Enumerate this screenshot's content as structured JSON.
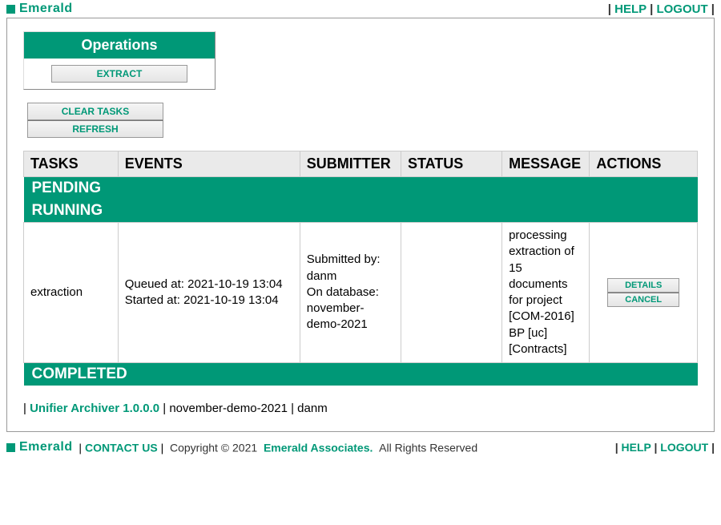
{
  "brand": "Emerald",
  "top": {
    "help": "HELP",
    "logout": "LOGOUT"
  },
  "ops": {
    "header": "Operations",
    "extract": "EXTRACT"
  },
  "util": {
    "clear": "CLEAR TASKS",
    "refresh": "REFRESH"
  },
  "table": {
    "headers": {
      "tasks": "TASKS",
      "events": "EVENTS",
      "submitter": "SUBMITTER",
      "status": "STATUS",
      "message": "MESSAGE",
      "actions": "ACTIONS"
    },
    "sections": {
      "pending": "PENDING",
      "running": "RUNNING",
      "completed": "COMPLETED"
    },
    "row": {
      "task": "extraction",
      "queued_label": "Queued at:",
      "queued": "2021-10-19 13:04",
      "started_label": "Started at:",
      "started": "2021-10-19 13:04",
      "submitted_by_label": "Submitted by:",
      "submitted_by": "danm",
      "on_db_label": "On database:",
      "on_db": "november-demo-2021",
      "status": "",
      "message": "processing extraction of 15 documents for project [COM-2016] BP [uc] [Contracts]",
      "details": "DETAILS",
      "cancel": "CANCEL"
    }
  },
  "footer": {
    "product": "Unifier Archiver",
    "version": "1.0.0.0",
    "db": "november-demo-2021",
    "user": "danm"
  },
  "bottom": {
    "contact": "CONTACT US",
    "copyright_prefix": "Copyright © 2021",
    "associates": "Emerald Associates.",
    "rights": "All Rights Reserved",
    "help": "HELP",
    "logout": "LOGOUT"
  }
}
